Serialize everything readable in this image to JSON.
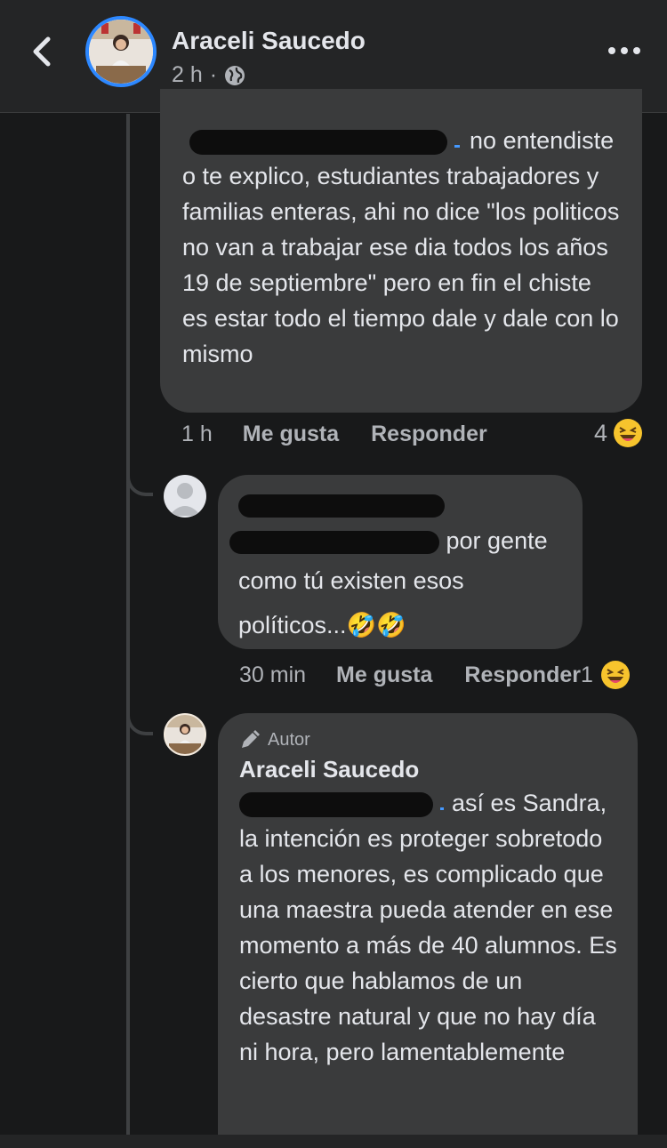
{
  "header": {
    "name": "Araceli Saucedo",
    "time": "2 h",
    "separator": "·"
  },
  "comments": [
    {
      "text_tail": "no entendiste",
      "text_rest": "o te explico, estudiantes trabajadores y familias enteras, ahi no dice \"los politicos no van a trabajar ese dia todos los años 19 de septiembre\" pero en fin el chiste es estar todo el tiempo dale y dale con lo mismo",
      "time": "1 h",
      "like_label": "Me gusta",
      "reply_label": "Responder",
      "reaction_count": "4"
    },
    {
      "text_tail": "por gente",
      "text_rest": "como tú existen esos políticos...🤣🤣",
      "time": "30 min",
      "like_label": "Me gusta",
      "reply_label": "Responder",
      "reaction_count": "1"
    },
    {
      "author_tag": "Autor",
      "author": "Araceli Saucedo",
      "text_tail": "así es Sandra,",
      "text_rest": "la intención es proteger sobretodo a los menores, es complicado que una maestra pueda atender en ese momento a más de 40 alumnos. Es cierto que hablamos de un desastre natural y que no hay día ni hora, pero lamentablemente"
    }
  ],
  "colors": {
    "background": "#18191a",
    "bubble": "#3a3b3c",
    "mention": "#4599ff",
    "avatar_ring": "#2d88ff"
  }
}
